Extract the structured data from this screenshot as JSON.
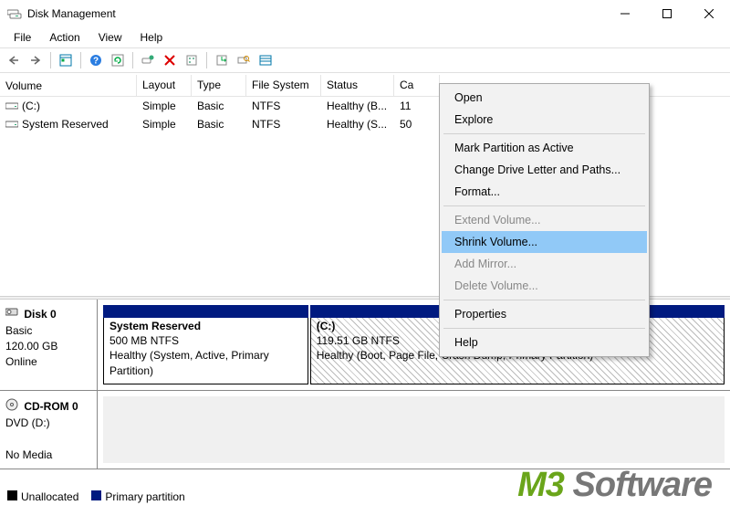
{
  "window": {
    "title": "Disk Management"
  },
  "menu": {
    "file": "File",
    "action": "Action",
    "view": "View",
    "help": "Help"
  },
  "columns": {
    "volume": "Volume",
    "layout": "Layout",
    "type": "Type",
    "fs": "File System",
    "status": "Status",
    "capacity": "Ca"
  },
  "volumes": [
    {
      "name": "(C:)",
      "layout": "Simple",
      "type": "Basic",
      "fs": "NTFS",
      "status": "Healthy (B...",
      "capacity": "11"
    },
    {
      "name": "System Reserved",
      "layout": "Simple",
      "type": "Basic",
      "fs": "NTFS",
      "status": "Healthy (S...",
      "capacity": "50"
    }
  ],
  "disks": [
    {
      "name": "Disk 0",
      "kind": "Basic",
      "size": "120.00 GB",
      "state": "Online",
      "parts": [
        {
          "name": "System Reserved",
          "sub": "500 MB NTFS",
          "status": "Healthy (System, Active, Primary Partition)",
          "selected": false,
          "widthPct": 33
        },
        {
          "name": "(C:)",
          "sub": "119.51 GB NTFS",
          "status": "Healthy (Boot, Page File, Crash Dump, Primary Partition)",
          "selected": true,
          "widthPct": 67
        }
      ]
    },
    {
      "name": "CD-ROM 0",
      "kind": "DVD (D:)",
      "size": "",
      "state": "No Media",
      "parts": []
    }
  ],
  "legend": {
    "unallocated": "Unallocated",
    "primary": "Primary partition"
  },
  "context": {
    "open": "Open",
    "explore": "Explore",
    "mark": "Mark Partition as Active",
    "change": "Change Drive Letter and Paths...",
    "format": "Format...",
    "extend": "Extend Volume...",
    "shrink": "Shrink Volume...",
    "mirror": "Add Mirror...",
    "delete": "Delete Volume...",
    "props": "Properties",
    "help": "Help"
  },
  "watermark": {
    "m3": "M3",
    "soft": " Software"
  }
}
